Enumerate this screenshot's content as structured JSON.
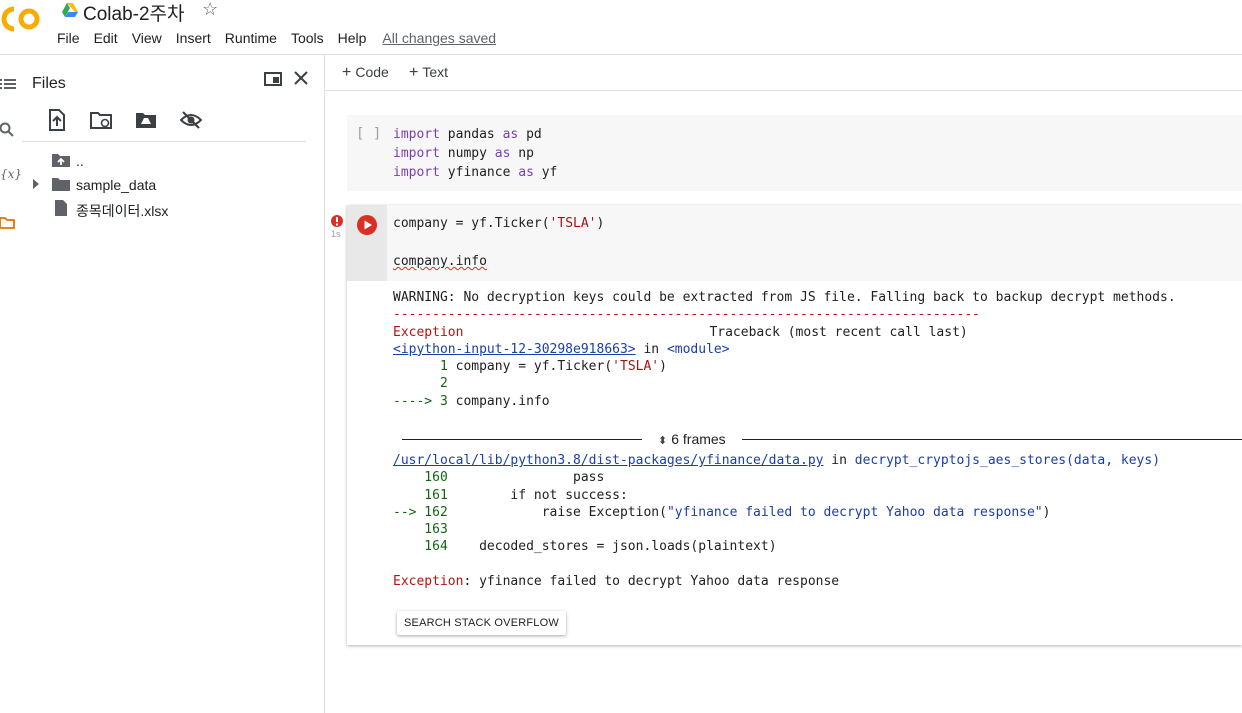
{
  "header": {
    "logo_text": "CO",
    "title": "Colab-2주차",
    "menu": [
      "File",
      "Edit",
      "View",
      "Insert",
      "Runtime",
      "Tools",
      "Help"
    ],
    "save_status": "All changes saved"
  },
  "sidebar": {
    "title": "Files",
    "tree": [
      {
        "label": "..",
        "type": "parent-folder"
      },
      {
        "label": "sample_data",
        "type": "folder"
      },
      {
        "label": "종목데이터.xlsx",
        "type": "file"
      }
    ]
  },
  "toolbar": {
    "code_label": "Code",
    "text_label": "Text"
  },
  "cell1": {
    "bracket": "[ ]",
    "lines": [
      {
        "kw1": "import",
        "mod": " pandas ",
        "kw2": "as",
        "alias": " pd"
      },
      {
        "kw1": "import",
        "mod": " numpy ",
        "kw2": "as",
        "alias": " np"
      },
      {
        "kw1": "import",
        "mod": " yfinance ",
        "kw2": "as",
        "alias": " yf"
      }
    ]
  },
  "cell2": {
    "exec_time": "1s",
    "line1_pre": "company = yf.Ticker(",
    "line1_str": "'TSLA'",
    "line1_post": ")",
    "line2": "company.info",
    "output": {
      "warning": "WARNING: No decryption keys could be extracted from JS file. Falling back to backup decrypt methods.",
      "dashes": "---------------------------------------------------------------------------",
      "exc_name": "Exception",
      "traceback_label": "Traceback (most recent call last)",
      "input_link": "<ipython-input-12-30298e918663>",
      "in_word": " in ",
      "module": "<module>",
      "tb1_num": "      1",
      "tb1_pre": " company = yf.Ticker(",
      "tb1_str": "'TSLA'",
      "tb1_post": ")",
      "tb2_num": "      2",
      "tb3_arrow": "----> 3",
      "tb3_code": " company.info",
      "frames_label": "6 frames",
      "path_link": "/usr/local/lib/python3.8/dist-packages/yfinance/data.py",
      "func": "decrypt_cryptojs_aes_stores(data, keys)",
      "f160_num": "    160",
      "f160_code": "                pass",
      "f161_num": "    161",
      "f161_code": "        if not success:",
      "f162_arrow": "--> 162",
      "f162_pre": "            raise Exception(",
      "f162_str": "\"yfinance failed to decrypt Yahoo data response\"",
      "f162_post": ")",
      "f163_num": "    163",
      "f164_num": "    164",
      "f164_code": "    decoded_stores = json.loads(plaintext)",
      "final_name": "Exception",
      "final_msg": ": yfinance failed to decrypt Yahoo data response"
    },
    "so_button": "SEARCH STACK OVERFLOW"
  },
  "colors": {
    "accent_orange": "#f9ab00",
    "error_red": "#b31412",
    "link_blue": "#1a3ea8",
    "keyword_purple": "#7b3fb5"
  }
}
